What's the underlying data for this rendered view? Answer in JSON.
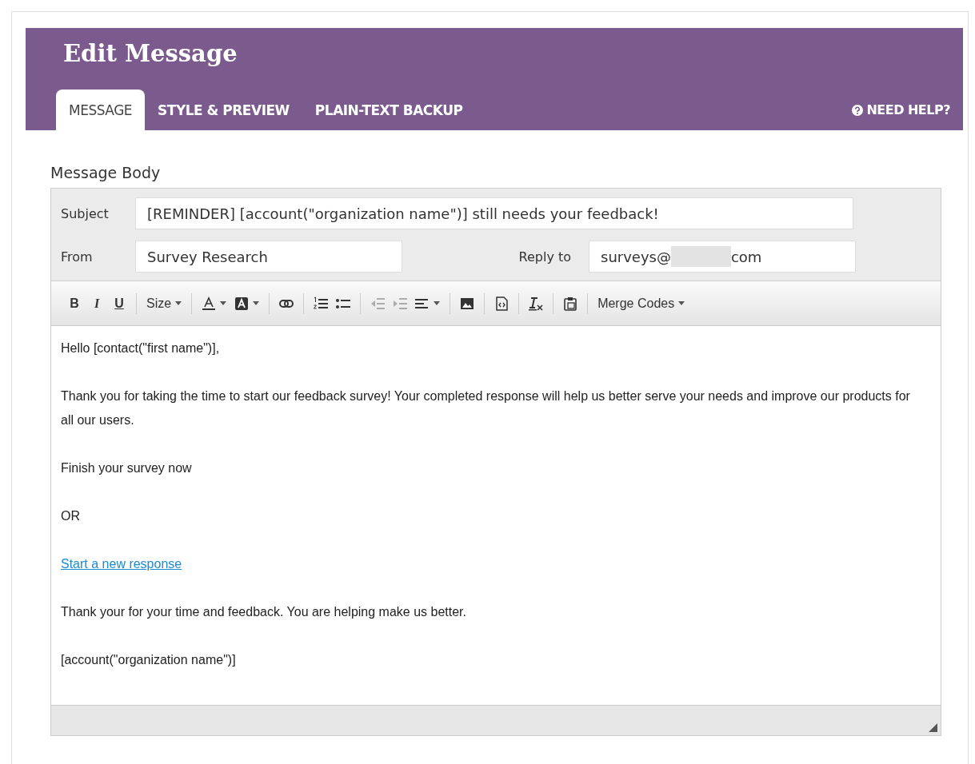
{
  "header": {
    "title": "Edit Message",
    "help": "NEED HELP?"
  },
  "tabs": [
    {
      "label": "MESSAGE",
      "selected": true
    },
    {
      "label": "STYLE & PREVIEW",
      "selected": false
    },
    {
      "label": "PLAIN-TEXT BACKUP",
      "selected": false
    }
  ],
  "section_label": "Message Body",
  "fields": {
    "subject": {
      "label": "Subject",
      "value": "[REMINDER] [account(\"organization name\")] still needs your feedback!"
    },
    "from": {
      "label": "From",
      "value": "Survey Research"
    },
    "reply_to": {
      "label": "Reply to",
      "value_before": "surveys@",
      "value_after": "com"
    }
  },
  "toolbar": [
    {
      "kind": "bold",
      "label": "B"
    },
    {
      "kind": "italic",
      "label": "I"
    },
    {
      "kind": "underline",
      "label": "U"
    },
    {
      "kind": "sep"
    },
    {
      "kind": "dropdown",
      "label": "Size"
    },
    {
      "kind": "sep"
    },
    {
      "kind": "textcolor"
    },
    {
      "kind": "bgcolor"
    },
    {
      "kind": "sep"
    },
    {
      "kind": "link"
    },
    {
      "kind": "sep"
    },
    {
      "kind": "ol"
    },
    {
      "kind": "ul"
    },
    {
      "kind": "sep"
    },
    {
      "kind": "outdent",
      "disabled": true
    },
    {
      "kind": "indent",
      "disabled": true
    },
    {
      "kind": "align"
    },
    {
      "kind": "sep"
    },
    {
      "kind": "image"
    },
    {
      "kind": "sep"
    },
    {
      "kind": "source"
    },
    {
      "kind": "sep"
    },
    {
      "kind": "clear"
    },
    {
      "kind": "sep"
    },
    {
      "kind": "paste"
    },
    {
      "kind": "sep"
    },
    {
      "kind": "dropdown",
      "label": "Merge Codes"
    }
  ],
  "body": [
    {
      "kind": "text",
      "text": "Hello [contact(\"first name\")],"
    },
    {
      "kind": "text",
      "text": "Thank you for taking the time to start our feedback survey! Your completed response will help us better serve your needs and improve our products for all our users."
    },
    {
      "kind": "text",
      "text": "Finish your survey now"
    },
    {
      "kind": "text",
      "text": "OR"
    },
    {
      "kind": "link",
      "text": "Start a new response"
    },
    {
      "kind": "text",
      "text": "Thank your for your time and feedback. You are helping make us better."
    },
    {
      "kind": "text",
      "text": "[account(\"organization name\")]"
    }
  ]
}
